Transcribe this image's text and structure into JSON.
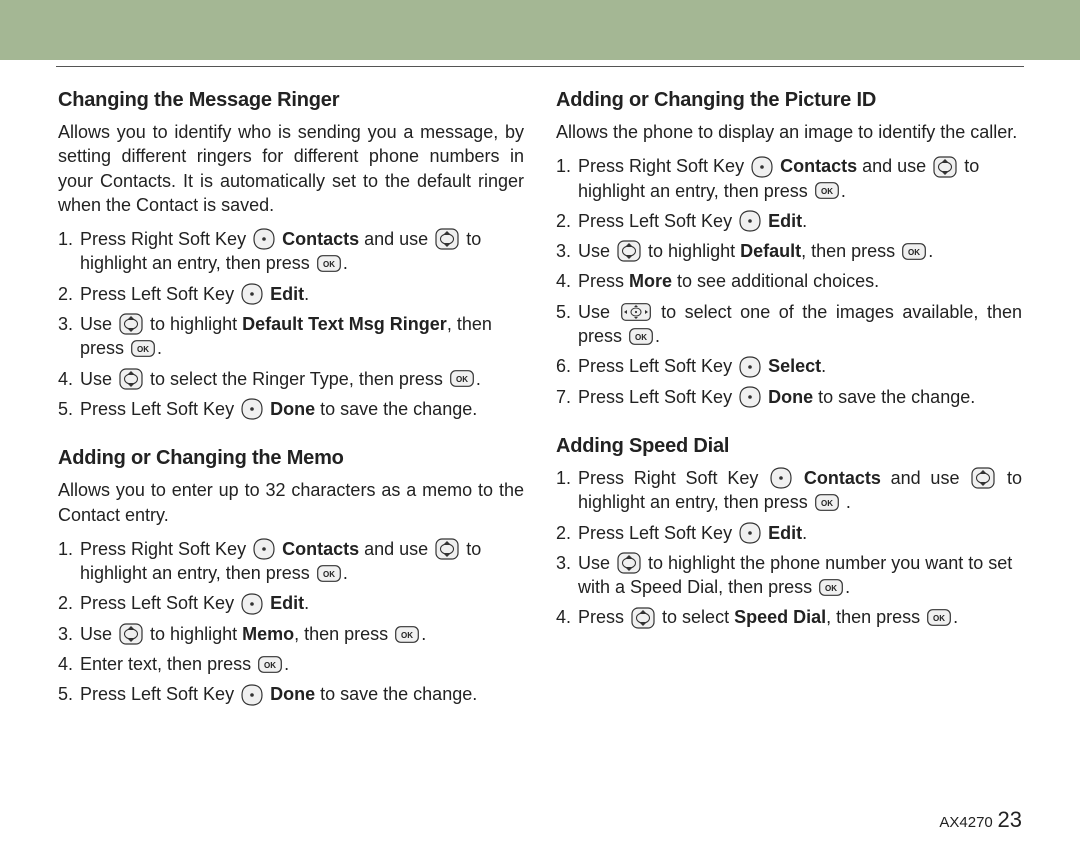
{
  "footer": {
    "model": "AX4270",
    "page": "23"
  },
  "left": {
    "sec1": {
      "title": "Changing the Message Ringer",
      "intro": "Allows you to identify who is sending you a message, by setting different ringers for different phone numbers in your Contacts. It is automatically set to the default ringer when the Contact is saved.",
      "steps": {
        "s1a": "Press Right Soft Key ",
        "s1_contacts": "Contacts",
        "s1b": " and use ",
        "s1c": " to highlight an entry, then press ",
        "s2a": "Press Left Soft Key ",
        "s2_edit": "Edit",
        "s3a": "Use ",
        "s3b": " to highlight ",
        "s3_bold": "Default Text Msg Ringer",
        "s3c": ", then press ",
        "s4a": "Use ",
        "s4b": " to select the Ringer Type, then press ",
        "s5a": "Press Left Soft Key ",
        "s5_done": "Done",
        "s5b": " to save the change."
      }
    },
    "sec2": {
      "title": "Adding or Changing the Memo",
      "intro": "Allows you to enter up to 32 characters as a memo to the Contact entry.",
      "steps": {
        "s1a": "Press Right Soft Key ",
        "s1_contacts": "Contacts",
        "s1b": " and use ",
        "s1c": " to highlight an entry, then press ",
        "s2a": "Press Left Soft Key ",
        "s2_edit": "Edit",
        "s3a": "Use ",
        "s3b": " to highlight ",
        "s3_bold": "Memo",
        "s3c": ", then press ",
        "s4a": "Enter text, then press ",
        "s5a": "Press Left Soft Key ",
        "s5_done": "Done",
        "s5b": " to save the change."
      }
    }
  },
  "right": {
    "sec1": {
      "title": "Adding or Changing the Picture ID",
      "intro": "Allows the phone to display an image to identify the caller.",
      "steps": {
        "s1a": "Press Right Soft Key ",
        "s1_contacts": "Contacts",
        "s1b": " and use ",
        "s1c": " to highlight an entry, then press ",
        "s2a": "Press Left Soft Key ",
        "s2_edit": "Edit",
        "s3a": "Use ",
        "s3b": " to highlight ",
        "s3_bold": "Default",
        "s3c": ", then press ",
        "s4a": "Press ",
        "s4_bold": "More",
        "s4b": " to see additional choices.",
        "s5a": "Use ",
        "s5b": " to select one of the images available, then press ",
        "s6a": "Press Left Soft Key ",
        "s6_bold": "Select",
        "s7a": "Press Left Soft Key ",
        "s7_done": "Done",
        "s7b": " to save the change."
      }
    },
    "sec2": {
      "title": "Adding Speed Dial",
      "steps": {
        "s1a": "Press Right Soft Key ",
        "s1_contacts": "Contacts",
        "s1b": " and use ",
        "s1c": " to highlight an entry, then press ",
        "s2a": "Press Left Soft Key ",
        "s2_edit": "Edit",
        "s3a": "Use ",
        "s3b": " to highlight the phone number you want to set with a Speed Dial, then press ",
        "s4a": "Press ",
        "s4b": " to select ",
        "s4_bold": "Speed Dial",
        "s4c": ", then press "
      }
    }
  }
}
